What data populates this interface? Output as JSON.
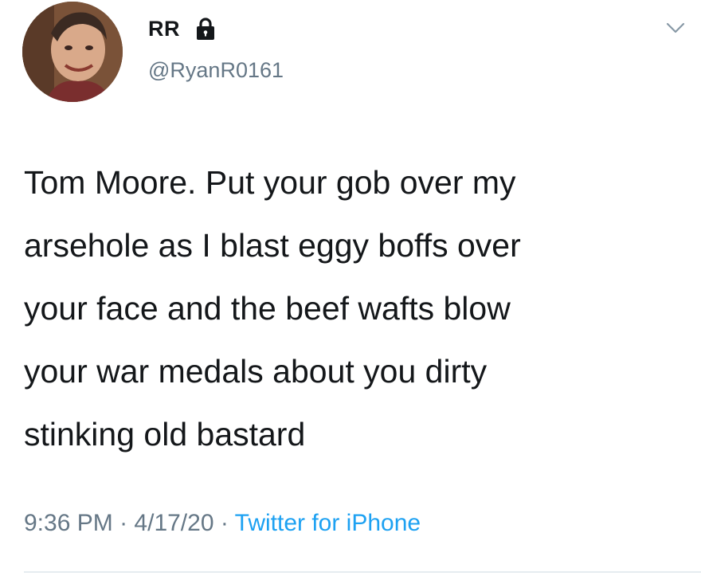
{
  "tweet": {
    "author": {
      "display_name": "RR",
      "handle": "@RyanR0161",
      "avatar_icon": "avatar-photo",
      "protected_icon": "lock-icon"
    },
    "text": "Tom Moore. Put your gob over my\narsehole as I blast eggy boffs over\nyour face and the beef wafts blow\nyour war medals about you dirty\nstinking old bastard",
    "time": "9:36 PM",
    "date": "4/17/20",
    "separator": "·",
    "source": "Twitter for iPhone"
  },
  "colors": {
    "text": "#14171a",
    "secondary": "#657786",
    "link": "#1da1f2",
    "divider": "#e6ecf0"
  }
}
